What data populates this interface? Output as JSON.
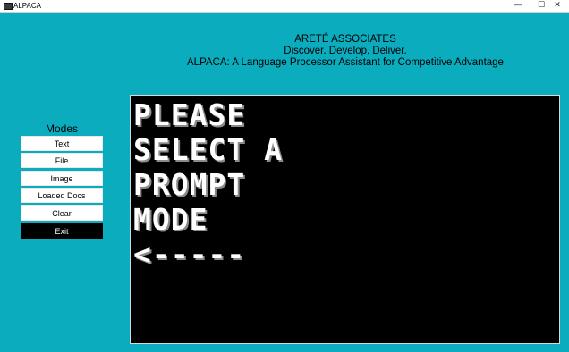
{
  "window": {
    "title": "ALPACA",
    "minimize_glyph": "—",
    "maximize_glyph": "☐",
    "close_glyph": "✕"
  },
  "header": {
    "company": "ARETÉ ASSOCIATES",
    "tagline": "Discover. Develop. Deliver.",
    "product": "ALPACA: A Language Processor Assistant for Competitive Advantage"
  },
  "modes": {
    "title": "Modes",
    "buttons": [
      "Text",
      "File",
      "Image",
      "Loaded Docs",
      "Clear",
      "Exit"
    ]
  },
  "console": {
    "lines": [
      "PLEASE",
      "SELECT A",
      "PROMPT",
      "MODE",
      "<-----"
    ]
  },
  "colors": {
    "background": "#0aacbe",
    "console_bg": "#000000",
    "exit_button_bg": "#000000"
  }
}
